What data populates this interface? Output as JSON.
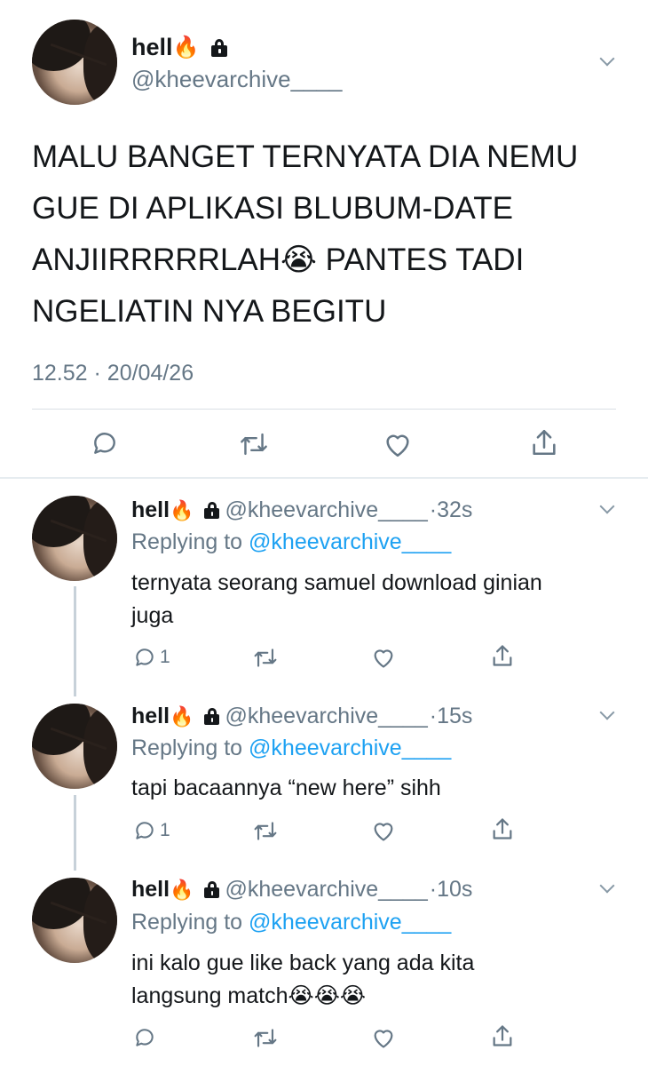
{
  "main_tweet": {
    "display_name": "hell",
    "name_emoji": "🔥",
    "handle": "@kheevarchive____",
    "text_lines": [
      "MALU BANGET TERNYATA DIA NEMU",
      "GUE DI APLIKASI BLUBUM-DATE",
      "ANJIIRRRRRLAH😭 PANTES TADI",
      "NGELIATIN NYA BEGITU"
    ],
    "time": "12.52",
    "separator": "·",
    "date": "20/04/26",
    "icons": {
      "reply": "reply-icon",
      "retweet": "retweet-icon",
      "like": "heart-icon",
      "share": "share-icon",
      "menu": "chevron-down-icon",
      "protected": "lock-icon"
    }
  },
  "replies": [
    {
      "display_name": "hell",
      "name_emoji": "🔥",
      "handle": "@kheevarchive____",
      "age": "·32s",
      "replying_prefix": "Replying to",
      "replying_to": "@kheevarchive____",
      "text_lines": [
        "ternyata seorang samuel download ginian",
        "juga"
      ],
      "reply_count": "1"
    },
    {
      "display_name": "hell",
      "name_emoji": "🔥",
      "handle": "@kheevarchive____",
      "age": "·15s",
      "replying_prefix": "Replying to",
      "replying_to": "@kheevarchive____",
      "text_lines": [
        "tapi bacaannya “new here” sihh"
      ],
      "reply_count": "1"
    },
    {
      "display_name": "hell",
      "name_emoji": "🔥",
      "handle": "@kheevarchive____",
      "age": "·10s",
      "replying_prefix": "Replying to",
      "replying_to": "@kheevarchive____",
      "text_lines": [
        "ini kalo gue like back yang ada kita",
        "langsung match😭😭😭"
      ],
      "reply_count": ""
    }
  ],
  "colors": {
    "text": "#14171a",
    "secondary": "#657786",
    "link": "#1da1f2",
    "divider": "#d9dfe4",
    "icon": "#657786"
  }
}
